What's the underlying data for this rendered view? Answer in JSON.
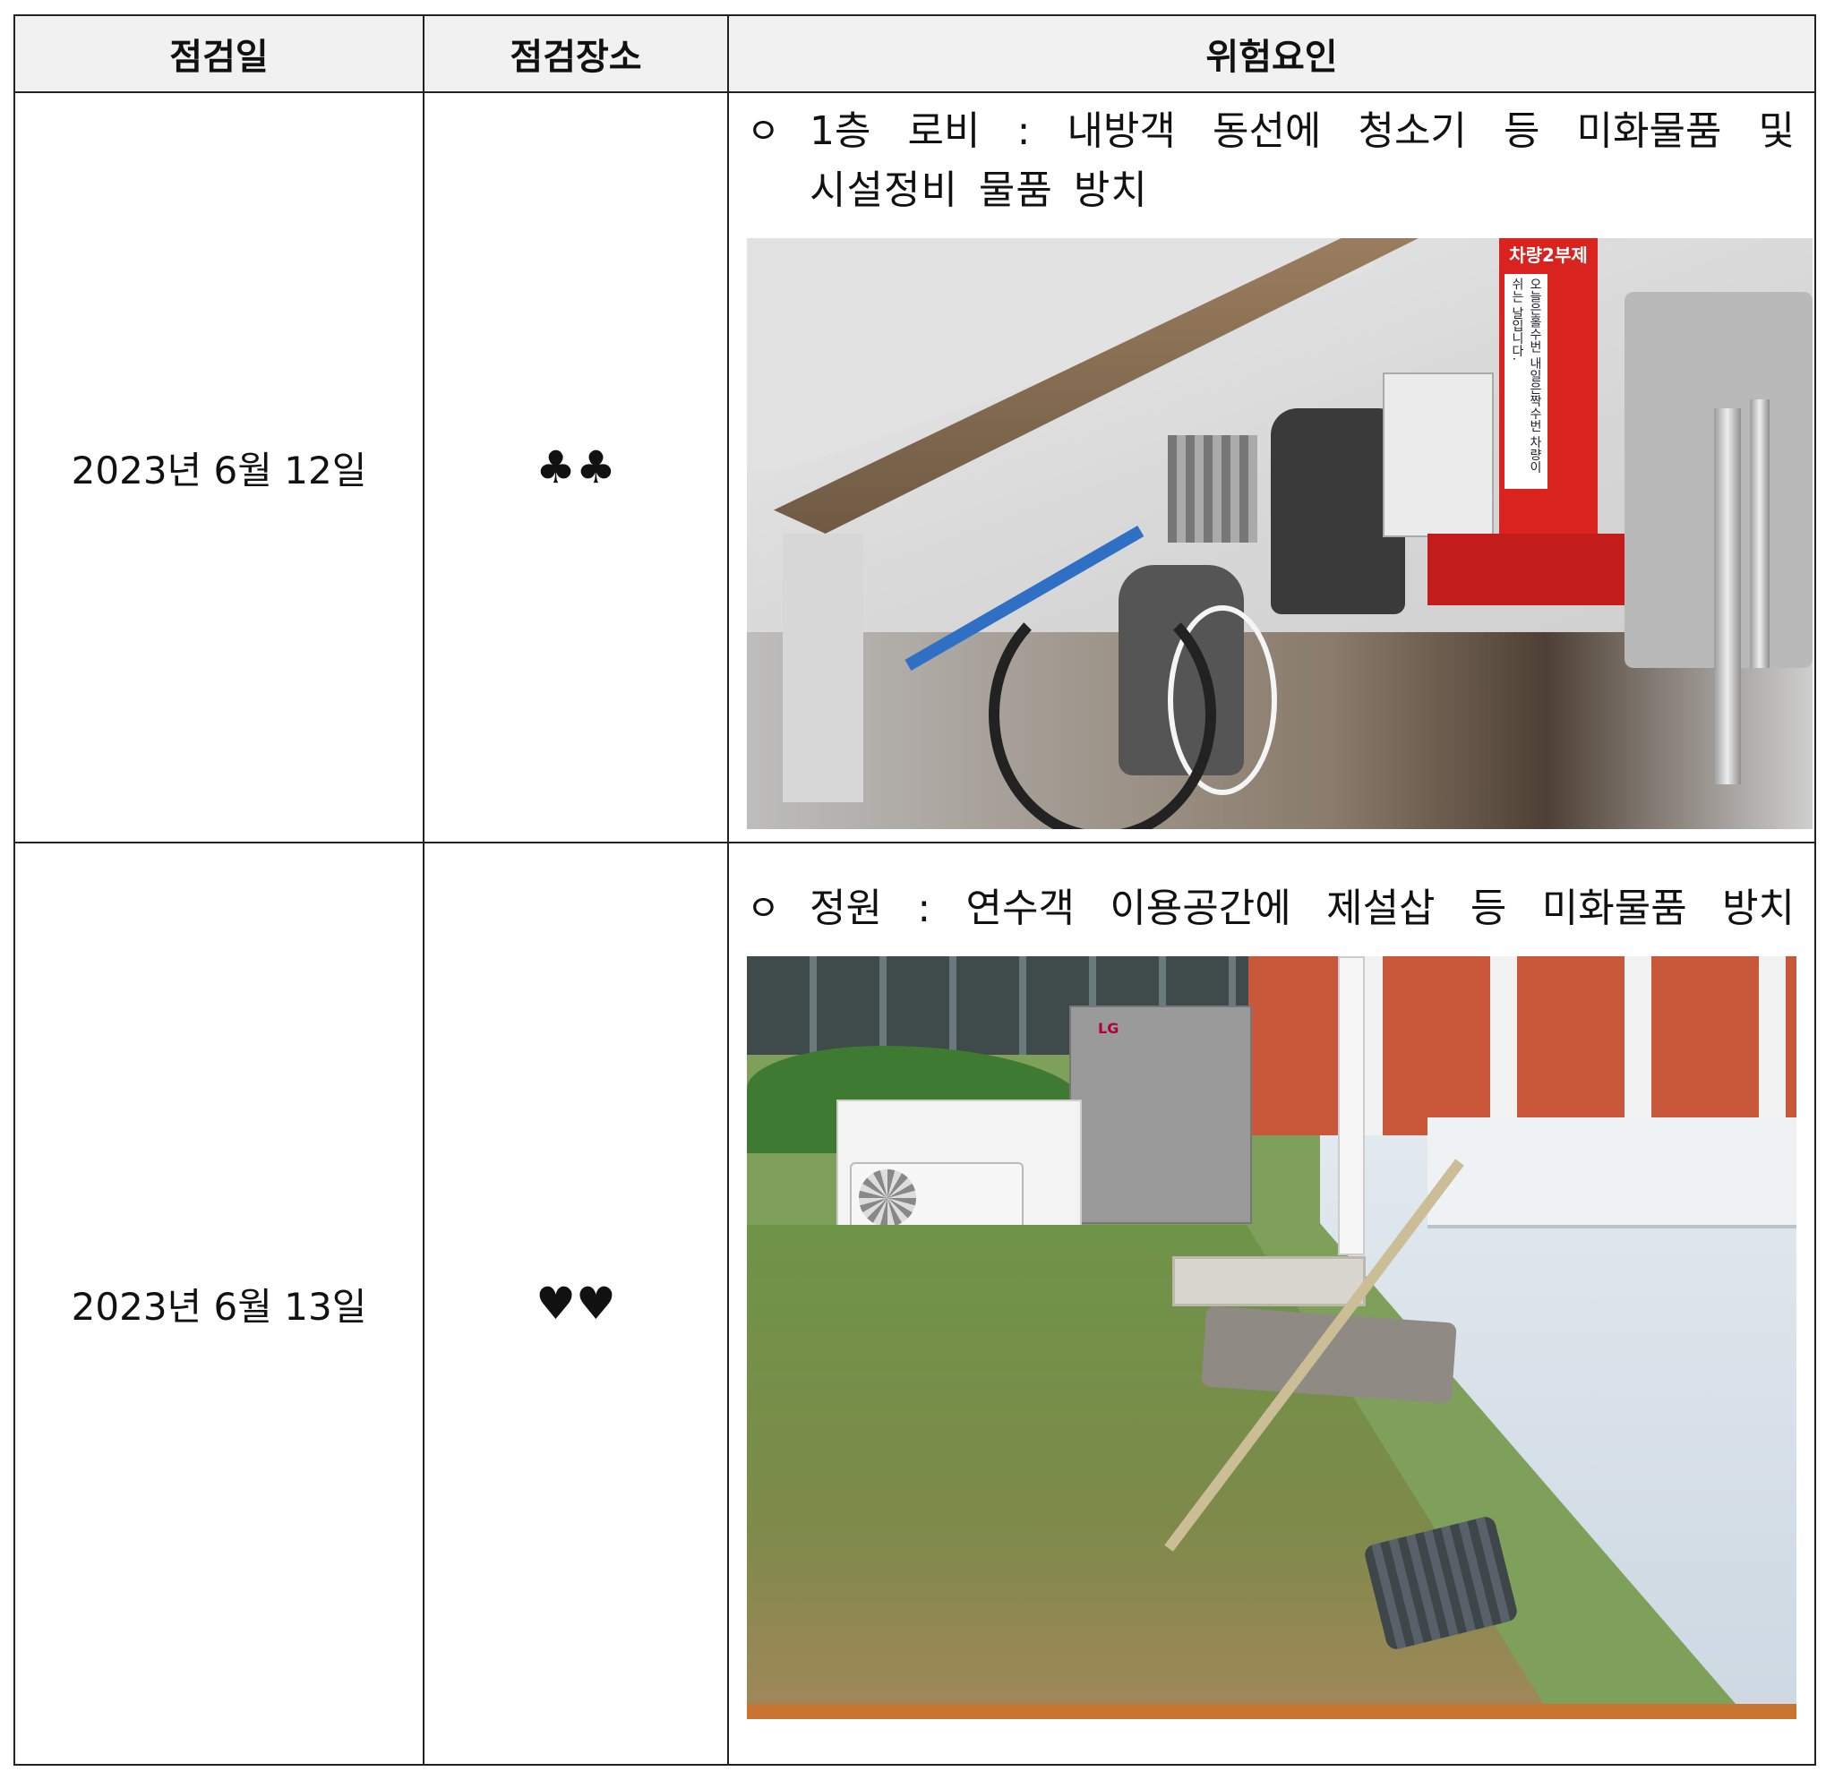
{
  "headers": {
    "date": "점검일",
    "place": "점검장소",
    "risk": "위험요인"
  },
  "rows": [
    {
      "date": "2023년 6월 12일",
      "place": "♣♣",
      "risk_bullet": "ㅇ",
      "risk_lines": [
        "1층 로비 : 내방객 동선에 청소기 등 미화물품 및",
        "시설정비 물품 방치"
      ],
      "photo_text": {
        "sign_title": "차량2부제",
        "sign_body": "오늘은홀수번 내일은짝수번 차량이 쉬는 날입니다."
      }
    },
    {
      "date": "2023년 6월 13일",
      "place": "♥♥",
      "risk_bullet": "ㅇ",
      "risk_lines": [
        "정원 : 연수객 이용공간에 제설삽 등 미화물품 방치"
      ],
      "photo_text": {
        "brand": "LG"
      }
    }
  ]
}
